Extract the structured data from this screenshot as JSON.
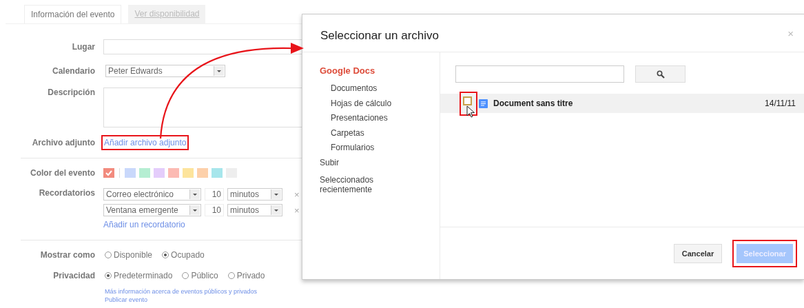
{
  "tabs": [
    {
      "label": "Información del evento",
      "selected": true
    },
    {
      "label": "Ver disponibilidad",
      "selected": false
    }
  ],
  "form": {
    "place": {
      "label": "Lugar"
    },
    "calendar": {
      "label": "Calendario",
      "value": "Peter Edwards"
    },
    "description": {
      "label": "Descripción"
    },
    "attachment": {
      "label": "Archivo adjunto",
      "link": "Añadir archivo adjunto",
      "highlighted": true
    },
    "event_color": {
      "label": "Color del evento",
      "swatches": [
        {
          "color": "#f28b7e",
          "selected": true
        },
        {
          "color": "#c9d8fb",
          "selected": false
        },
        {
          "color": "#b5eed2",
          "selected": false
        },
        {
          "color": "#e4cdfb",
          "selected": false
        },
        {
          "color": "#fcbab3",
          "selected": false
        },
        {
          "color": "#fde49c",
          "selected": false
        },
        {
          "color": "#fdd0aa",
          "selected": false
        },
        {
          "color": "#a7e6ec",
          "selected": false
        },
        {
          "color": "#eeeeee",
          "selected": false
        }
      ]
    },
    "reminders": {
      "label": "Recordatorios",
      "items": [
        {
          "method": "Correo electrónico",
          "amount": "10",
          "unit": "minutos",
          "remove": "×"
        },
        {
          "method": "Ventana emergente",
          "amount": "10",
          "unit": "minutos",
          "remove": "×"
        }
      ],
      "add_link": "Añadir un recordatorio"
    },
    "show_as": {
      "label": "Mostrar como",
      "options": [
        {
          "label": "Disponible",
          "selected": false
        },
        {
          "label": "Ocupado",
          "selected": true
        }
      ]
    },
    "privacy": {
      "label": "Privacidad",
      "options": [
        {
          "label": "Predeterminado",
          "selected": true
        },
        {
          "label": "Público",
          "selected": false
        },
        {
          "label": "Privado",
          "selected": false
        }
      ]
    },
    "links": [
      "Más información acerca de eventos públicos y privados",
      "Publicar evento"
    ]
  },
  "dialog": {
    "title": "Seleccionar un archivo",
    "close": "×",
    "sidebar": {
      "items": [
        {
          "label": "Google Docs",
          "selected": true,
          "children": [
            {
              "label": "Documentos",
              "selected": false
            },
            {
              "label": "Hojas de cálculo",
              "selected": false
            },
            {
              "label": "Presentaciones",
              "selected": false
            },
            {
              "label": "Carpetas",
              "selected": false
            },
            {
              "label": "Formularios",
              "selected": false
            }
          ]
        },
        {
          "label": "Subir",
          "selected": false
        },
        {
          "label": "Seleccionados recientemente",
          "selected": false
        }
      ]
    },
    "files": [
      {
        "name": "Document sans titre",
        "date": "14/11/11",
        "checked": false,
        "highlighted": true
      }
    ],
    "buttons": [
      {
        "label": "Cancelar",
        "kind": "default",
        "disabled": false,
        "highlighted": false
      },
      {
        "label": "Seleccionar",
        "kind": "primary",
        "disabled": true,
        "highlighted": true
      }
    ]
  }
}
